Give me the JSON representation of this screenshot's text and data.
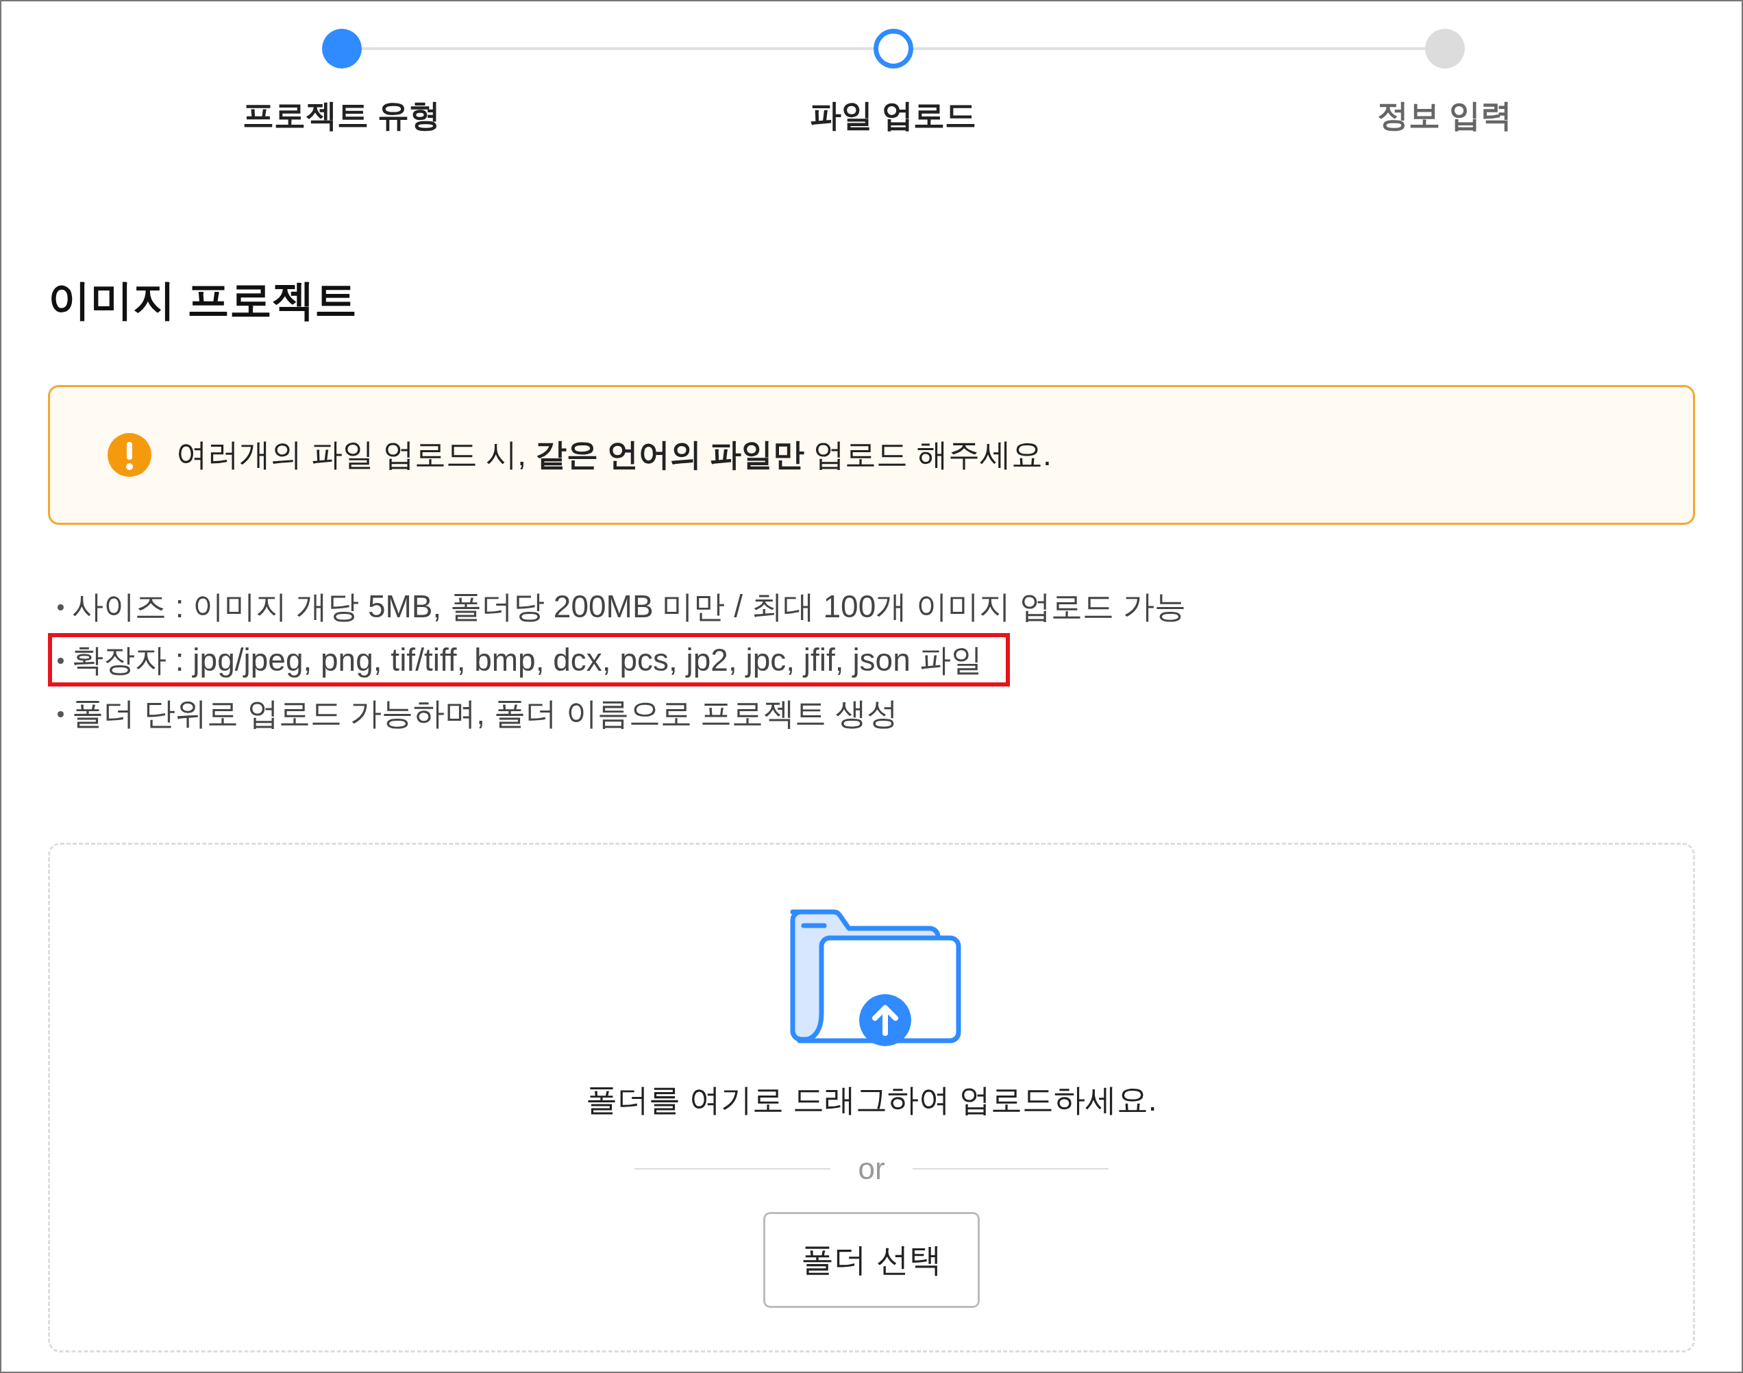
{
  "steps": [
    {
      "label": "프로젝트 유형",
      "completed": true,
      "selected": false
    },
    {
      "label": "파일 업로드",
      "completed": false,
      "selected": true
    },
    {
      "label": "정보 입력",
      "completed": false,
      "selected": false
    }
  ],
  "title": "이미지 프로젝트",
  "alert": {
    "text": "여러개의 파일 업로드 시, **같은 언어의 파일만** 업로드 해주세요."
  },
  "notes": [
    {
      "text": "사이즈 : 이미지 개당 5MB, 폴더당 200MB 미만 / 최대 100개 이미지 업로드 가능",
      "highlighted": false
    },
    {
      "text": "확장자 : jpg/jpeg, png, tif/tiff, bmp, dcx, pcs, jp2, jpc, jfif, json 파일",
      "highlighted": true
    },
    {
      "text": "폴더 단위로 업로드 가능하며, 폴더 이름으로 프로젝트 생성",
      "highlighted": false
    }
  ],
  "dropzone": {
    "hint": "폴더를 여기로 드래그하여 업로드하세요.",
    "divider": "or",
    "button": "폴더 선택"
  }
}
